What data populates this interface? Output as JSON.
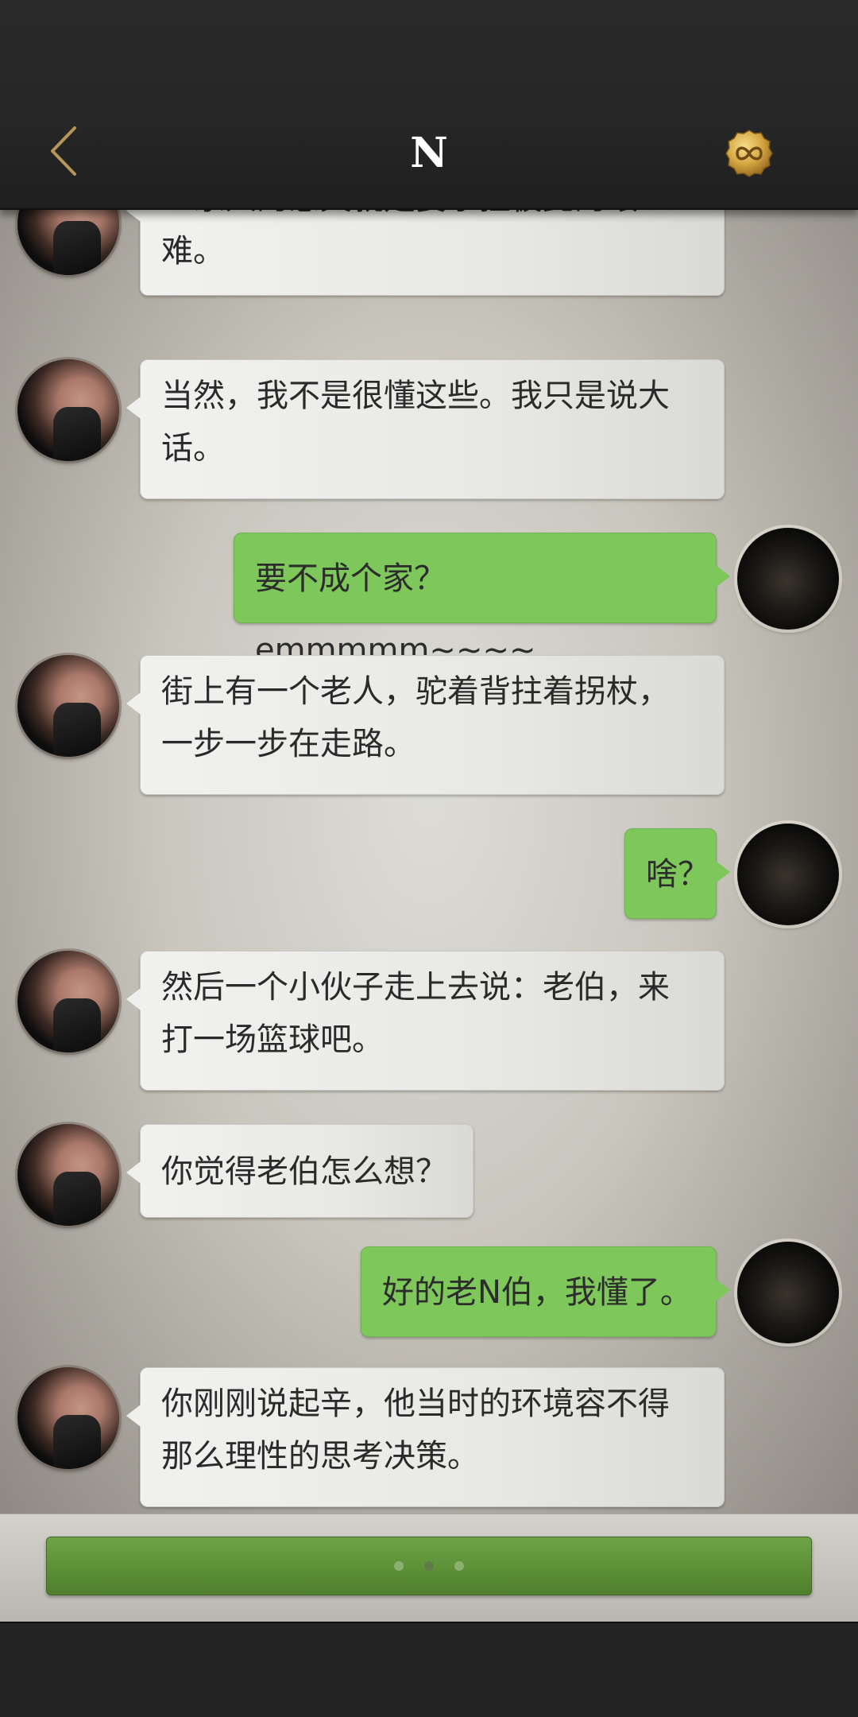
{
  "header": {
    "title": "N",
    "back_icon": "chevron-left-icon",
    "coin_icon": "infinity-coin-icon",
    "accent_color": "#b8955a"
  },
  "messages": [
    {
      "side": "left",
      "text_lines": [
        "一家人的意义就是要承担彼此的艰",
        "难。"
      ]
    },
    {
      "side": "left",
      "text_lines": [
        "当然，我不是很懂这些。我只是说大",
        "话。"
      ]
    },
    {
      "side": "right",
      "text_lines": [
        "要不成个家？emmmmm~~~~"
      ]
    },
    {
      "side": "left",
      "text_lines": [
        "街上有一个老人，驼着背拄着拐杖，",
        "一步一步在走路。"
      ]
    },
    {
      "side": "right",
      "text_lines": [
        "啥？"
      ]
    },
    {
      "side": "left",
      "text_lines": [
        "然后一个小伙子走上去说：老伯，来",
        "打一场篮球吧。"
      ]
    },
    {
      "side": "left",
      "text_lines": [
        "你觉得老伯怎么想？"
      ]
    },
    {
      "side": "right",
      "text_lines": [
        "好的老N伯，我懂了。"
      ]
    },
    {
      "side": "left",
      "text_lines": [
        "你刚刚说起辛，他当时的环境容不得",
        "那么理性的思考决策。"
      ]
    }
  ],
  "input": {
    "typing_indicator": "• • •",
    "button_color": "#5b8f36"
  },
  "colors": {
    "incoming_bubble": "#ececea",
    "outgoing_bubble": "#7ec75b",
    "topbar": "#262626"
  }
}
